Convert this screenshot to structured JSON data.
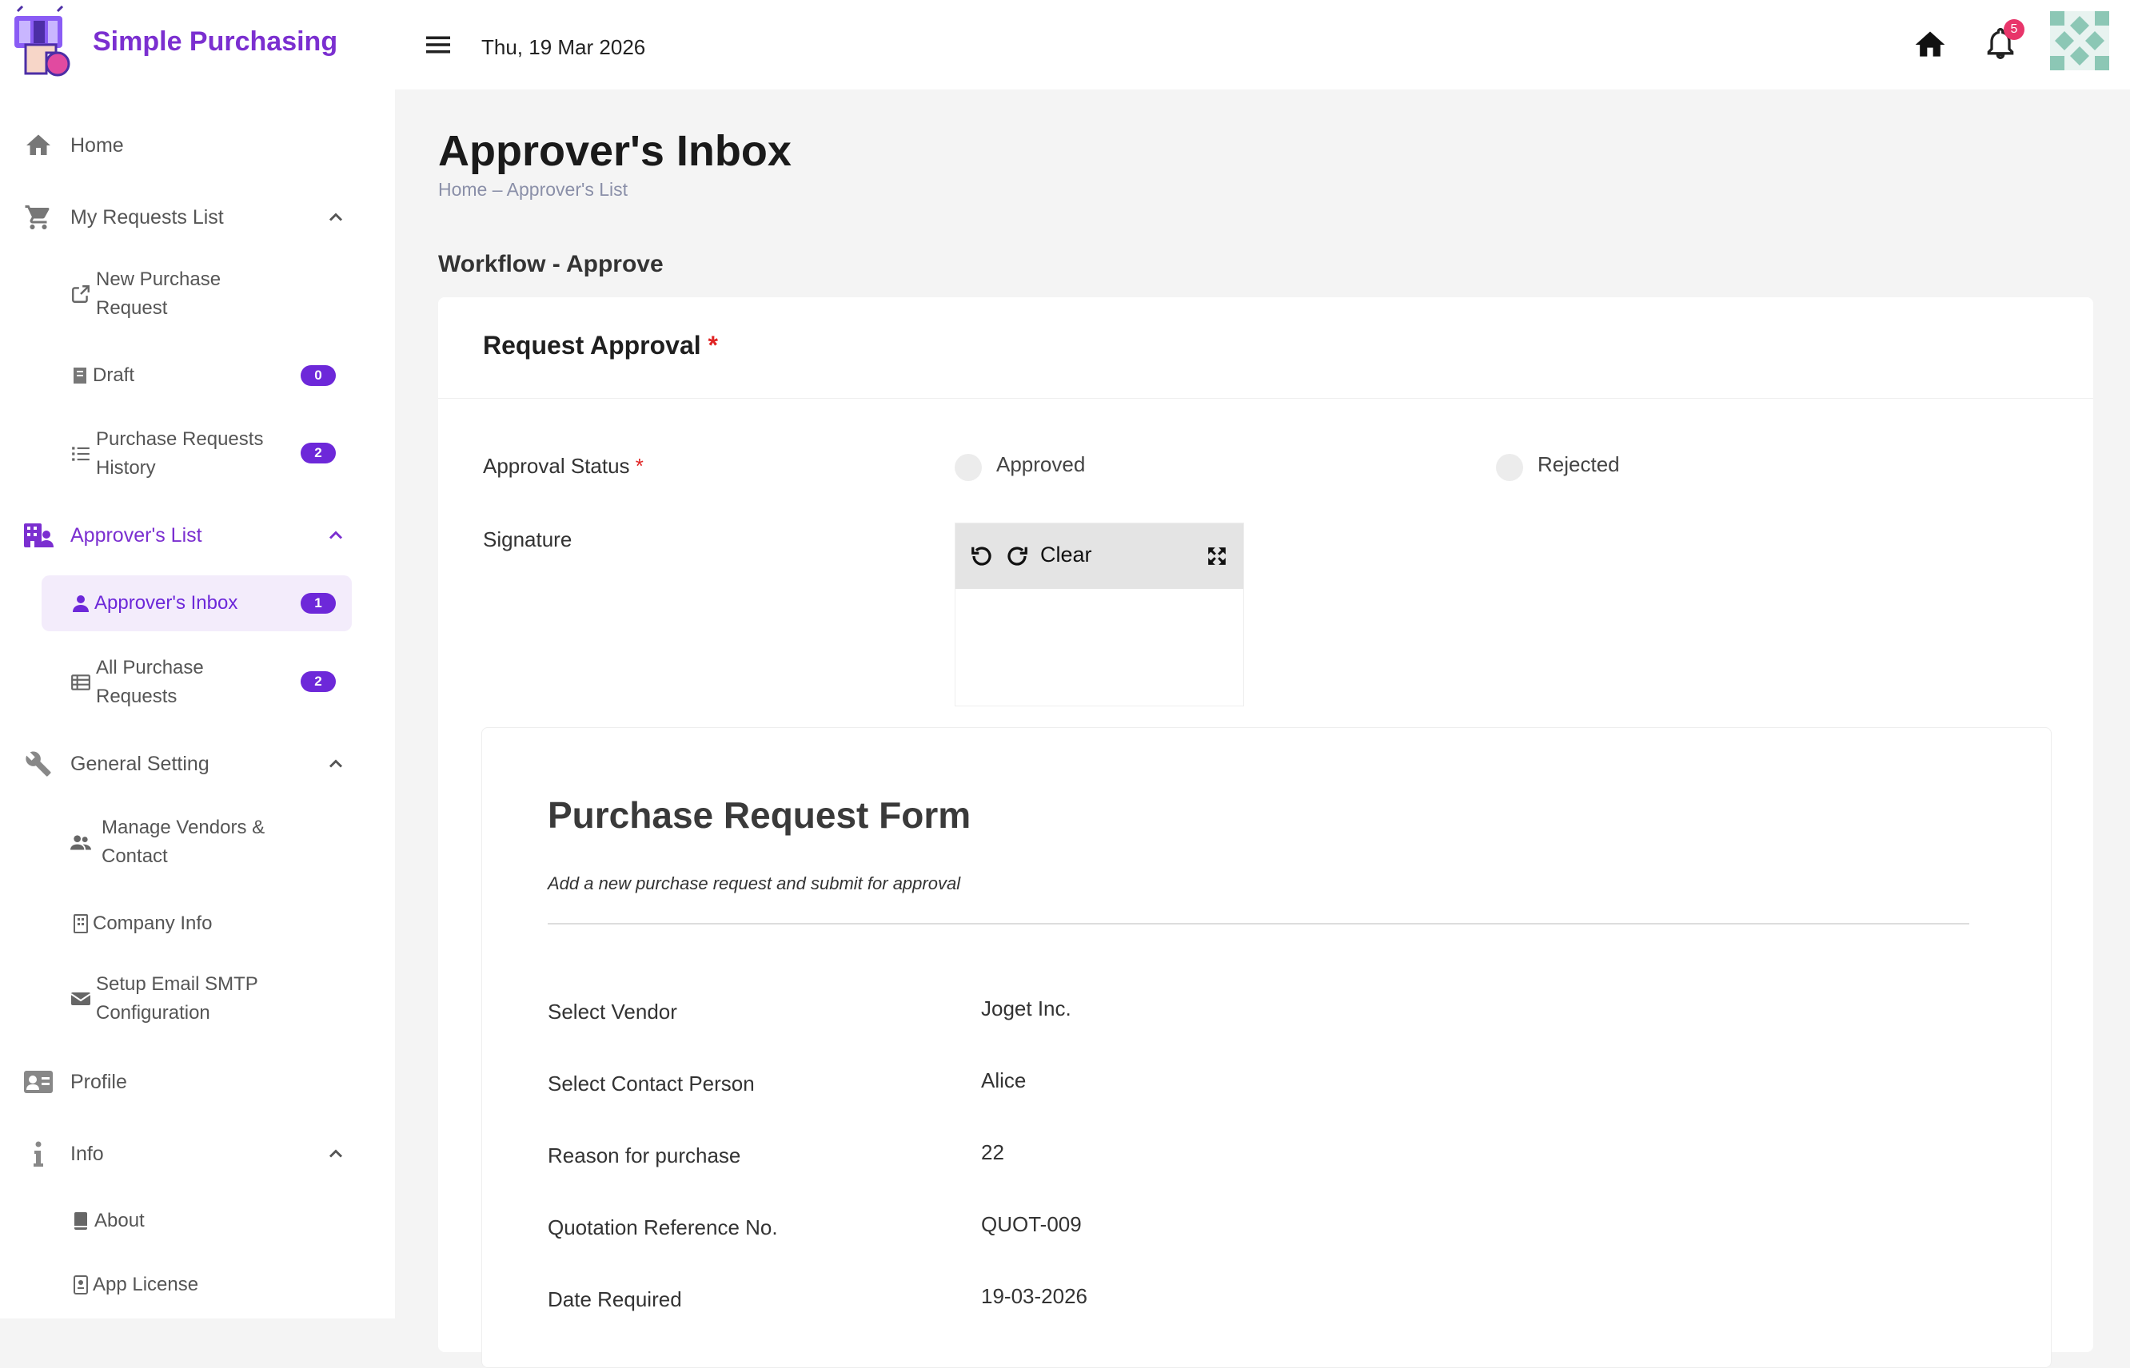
{
  "app": {
    "name": "Simple Purchasing"
  },
  "topbar": {
    "date": "Thu, 19 Mar 2026",
    "notification_count": "5"
  },
  "sidebar": {
    "items": [
      {
        "label": "Home"
      },
      {
        "label": "My Requests List"
      },
      {
        "label": "Approver's List"
      },
      {
        "label": "General Setting"
      },
      {
        "label": "Profile"
      },
      {
        "label": "Info"
      }
    ],
    "my_requests": [
      {
        "label": "New Purchase Request"
      },
      {
        "label": "Draft",
        "badge": "0"
      },
      {
        "label": "Purchase Requests History",
        "badge": "2"
      }
    ],
    "approvers": [
      {
        "label": "Approver's Inbox",
        "badge": "1"
      },
      {
        "label": "All Purchase Requests",
        "badge": "2"
      }
    ],
    "general": [
      {
        "label": "Manage Vendors & Contact"
      },
      {
        "label": "Company Info"
      },
      {
        "label": "Setup Email SMTP Configuration"
      }
    ],
    "info": [
      {
        "label": "About"
      },
      {
        "label": "App License"
      }
    ]
  },
  "main": {
    "title": "Approver's Inbox",
    "breadcrumb": "Home – Approver's List",
    "section": "Workflow - Approve",
    "card_title": "Request Approval",
    "required_mark": "*",
    "approval_status_label": "Approval Status",
    "options": [
      "Approved",
      "Rejected"
    ],
    "signature_label": "Signature",
    "signature_clear": "Clear"
  },
  "form": {
    "title": "Purchase Request Form",
    "subtitle": "Add a new purchase request and submit for approval",
    "rows": [
      {
        "label": "Select Vendor",
        "value": "Joget Inc."
      },
      {
        "label": "Select Contact Person",
        "value": "Alice"
      },
      {
        "label": "Reason for purchase",
        "value": "22"
      },
      {
        "label": "Quotation Reference No.",
        "value": "QUOT-009"
      },
      {
        "label": "Date Required",
        "value": "19-03-2026"
      }
    ]
  },
  "colors": {
    "accent": "#7b2fd0",
    "badge": "#6d28d9",
    "notification": "#e8356a",
    "required": "#e02424"
  }
}
